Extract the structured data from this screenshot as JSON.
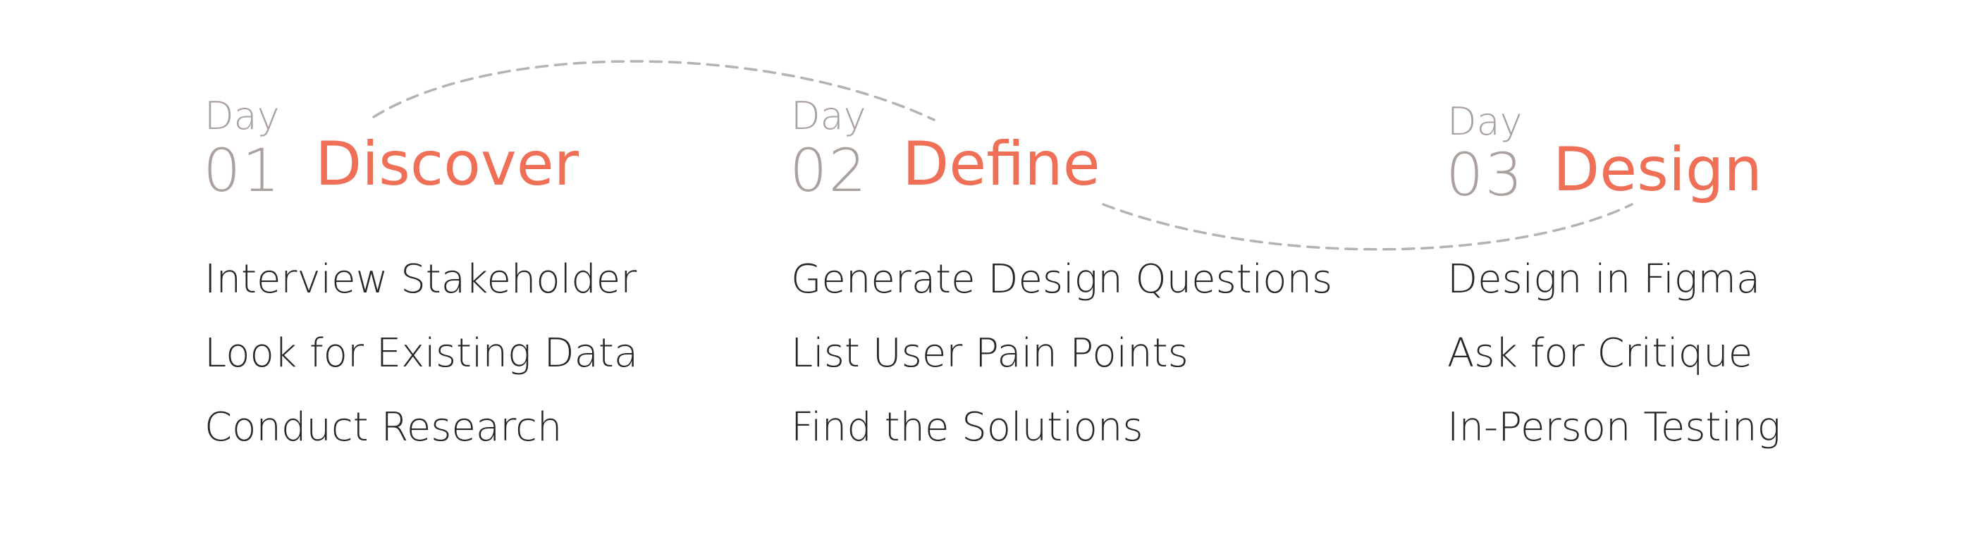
{
  "phases": [
    {
      "day_label": "Day",
      "day_number": "01",
      "title": "Discover",
      "tasks": [
        "Interview Stakeholder",
        "Look for Existing Data",
        "Conduct Research"
      ]
    },
    {
      "day_label": "Day",
      "day_number": "02",
      "title": "Define",
      "tasks": [
        "Generate Design Questions",
        "List User Pain Points",
        "Find the Solutions"
      ]
    },
    {
      "day_label": "Day",
      "day_number": "03",
      "title": "Design",
      "tasks": [
        "Design in Figma",
        "Ask for Critique",
        "In-Person Testing"
      ]
    }
  ],
  "colors": {
    "accent": "#ef7057",
    "muted": "#aaa19f",
    "text": "#262626",
    "connector": "#b3b3b3"
  }
}
